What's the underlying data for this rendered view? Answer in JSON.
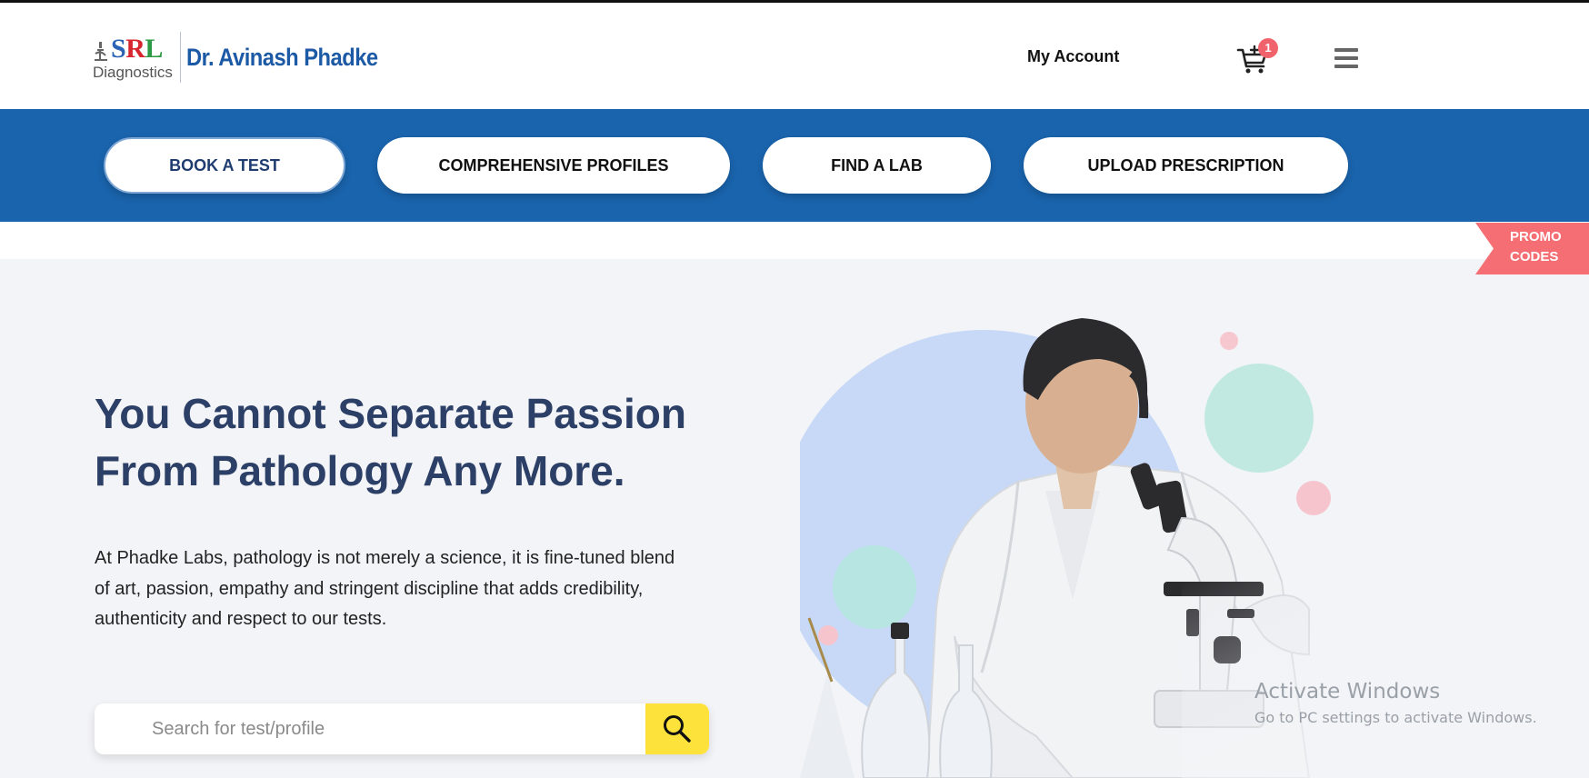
{
  "header": {
    "logo": {
      "srl_s": "S",
      "srl_r": "R",
      "srl_l": "L",
      "srl_sub": "Diagnostics",
      "brand": "Dr. Avinash Phadke"
    },
    "my_account": "My Account",
    "cart_count": "1",
    "cart_icon": "cart-icon",
    "menu_icon": "hamburger-menu-icon"
  },
  "nav": {
    "items": [
      {
        "label": "BOOK A TEST",
        "active": true
      },
      {
        "label": "COMPREHENSIVE PROFILES",
        "active": false
      },
      {
        "label": "FIND A LAB",
        "active": false
      },
      {
        "label": "UPLOAD PRESCRIPTION",
        "active": false
      }
    ]
  },
  "promo": {
    "line1": "PROMO",
    "line2": "CODES"
  },
  "hero": {
    "title_line1": "You Cannot Separate Passion",
    "title_line2": "From Pathology Any More.",
    "text_line1": "At Phadke Labs, pathology is not merely a science, it is fine-tuned blend",
    "text_line2": "of art, passion, empathy and stringent discipline that adds credibility,",
    "text_line3": "authenticity and respect to our tests.",
    "search_placeholder": "Search for test/profile",
    "search_value": "",
    "search_icon": "search-icon"
  },
  "watermark": {
    "title": "Activate Windows",
    "subtitle": "Go to PC settings to activate Windows."
  },
  "colors": {
    "nav_bg": "#1a64ad",
    "title": "#2c3f66",
    "promo": "#f56e73",
    "search_button": "#fde23b",
    "brand": "#1d5aa6"
  }
}
